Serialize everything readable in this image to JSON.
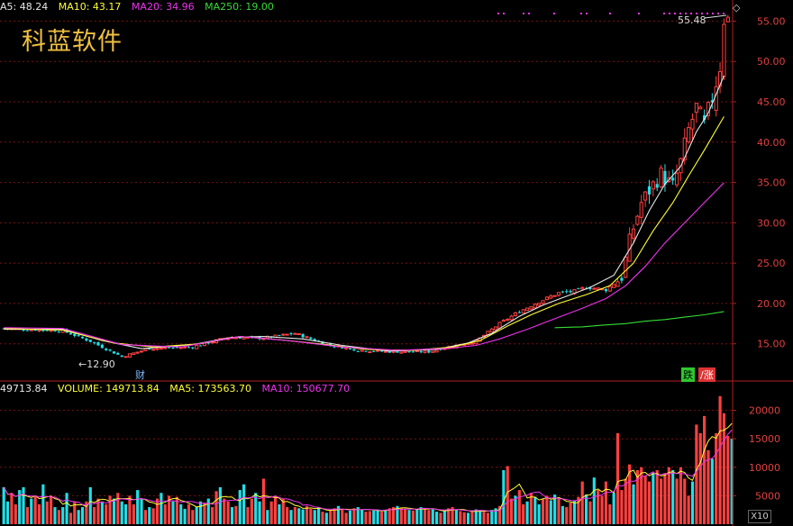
{
  "stock_name": "科蓝软件",
  "price_legend": {
    "ma5": "A5: 48.24",
    "ma10": "MA10: 43.17",
    "ma20": "MA20: 34.96",
    "ma250": "MA250: 19.00"
  },
  "volume_legend": {
    "current": "49713.84",
    "volume": "VOLUME: 149713.84",
    "ma5": "MA5: 173563.70",
    "ma10": "MA10: 150677.70"
  },
  "annotations": {
    "high": "55.48",
    "low": "12.90",
    "cai": "财",
    "die": "跌",
    "zhang": "涨"
  },
  "zoom_button": "X10",
  "colors": {
    "up": "#ff4040",
    "down": "#1fe0e8",
    "ma5": "#e8e8e8",
    "ma10": "#ffff33",
    "ma20": "#ee33ee",
    "ma250": "#33dd33",
    "grid": "#7a1010",
    "name": "#f0c040"
  },
  "chart_data": [
    {
      "type": "candlestick",
      "title": "科蓝软件",
      "ylim": [
        10.5,
        56.5
      ],
      "yticks": [
        "15.00",
        "20.00",
        "25.00",
        "30.00",
        "35.00",
        "40.00",
        "45.00",
        "50.00",
        "55.00"
      ],
      "grid": true,
      "close_path": [
        [
          0,
          16.9
        ],
        [
          15,
          16.6
        ],
        [
          22,
          15.3
        ],
        [
          30,
          13.4
        ],
        [
          37,
          14.4
        ],
        [
          48,
          14.6
        ],
        [
          57,
          15.8
        ],
        [
          66,
          15.7
        ],
        [
          74,
          16.3
        ],
        [
          82,
          14.9
        ],
        [
          90,
          14.2
        ],
        [
          98,
          14.0
        ],
        [
          108,
          14.0
        ],
        [
          113,
          14.6
        ],
        [
          120,
          15.3
        ],
        [
          126,
          17.5
        ],
        [
          131,
          19.0
        ],
        [
          136,
          20.2
        ],
        [
          141,
          21.3
        ],
        [
          145,
          21.5
        ],
        [
          148,
          22.0
        ],
        [
          153,
          21.7
        ],
        [
          157,
          23.2
        ],
        [
          159,
          27.8
        ],
        [
          162,
          32.5
        ],
        [
          165,
          34.7
        ],
        [
          167,
          36.0
        ],
        [
          170,
          34.5
        ],
        [
          172,
          37.5
        ],
        [
          174,
          41.5
        ],
        [
          176,
          44.2
        ],
        [
          178,
          42.0
        ],
        [
          180,
          45.5
        ],
        [
          182,
          49.5
        ],
        [
          183,
          55.48
        ]
      ],
      "series": [
        {
          "name": "MA5",
          "points": [
            [
              0,
              16.8
            ],
            [
              15,
              16.8
            ],
            [
              25,
              15.4
            ],
            [
              35,
              14.4
            ],
            [
              48,
              14.9
            ],
            [
              58,
              15.8
            ],
            [
              66,
              15.9
            ],
            [
              76,
              15.6
            ],
            [
              86,
              14.8
            ],
            [
              98,
              14.1
            ],
            [
              110,
              14.3
            ],
            [
              118,
              15.1
            ],
            [
              124,
              16.3
            ],
            [
              131,
              18.4
            ],
            [
              137,
              19.8
            ],
            [
              143,
              20.9
            ],
            [
              149,
              22.0
            ],
            [
              155,
              23.5
            ],
            [
              160,
              27.5
            ],
            [
              164,
              31.5
            ],
            [
              168,
              34.8
            ],
            [
              172,
              37.0
            ],
            [
              176,
              41.3
            ],
            [
              179,
              43.6
            ],
            [
              183,
              48.24
            ]
          ]
        },
        {
          "name": "MA10",
          "points": [
            [
              0,
              16.9
            ],
            [
              15,
              16.7
            ],
            [
              28,
              15.1
            ],
            [
              38,
              14.6
            ],
            [
              50,
              15.0
            ],
            [
              60,
              15.9
            ],
            [
              70,
              15.5
            ],
            [
              80,
              15.0
            ],
            [
              92,
              14.3
            ],
            [
              104,
              14.2
            ],
            [
              114,
              14.6
            ],
            [
              121,
              15.4
            ],
            [
              128,
              17.2
            ],
            [
              134,
              18.6
            ],
            [
              141,
              20.0
            ],
            [
              148,
              21.1
            ],
            [
              154,
              22.2
            ],
            [
              160,
              25.0
            ],
            [
              165,
              29.0
            ],
            [
              170,
              32.5
            ],
            [
              174,
              35.8
            ],
            [
              178,
              39.0
            ],
            [
              183,
              43.17
            ]
          ]
        },
        {
          "name": "MA20",
          "points": [
            [
              0,
              17.0
            ],
            [
              15,
              16.9
            ],
            [
              30,
              14.9
            ],
            [
              45,
              14.6
            ],
            [
              60,
              15.9
            ],
            [
              72,
              15.4
            ],
            [
              86,
              14.6
            ],
            [
              100,
              14.2
            ],
            [
              112,
              14.4
            ],
            [
              120,
              14.8
            ],
            [
              126,
              15.6
            ],
            [
              133,
              16.8
            ],
            [
              140,
              18.1
            ],
            [
              147,
              19.4
            ],
            [
              153,
              20.6
            ],
            [
              158,
              22.2
            ],
            [
              163,
              24.6
            ],
            [
              168,
              27.5
            ],
            [
              173,
              30.0
            ],
            [
              178,
              32.5
            ],
            [
              183,
              34.96
            ]
          ]
        },
        {
          "name": "MA250",
          "points": [
            [
              140,
              17.0
            ],
            [
              147,
              17.1
            ],
            [
              152,
              17.3
            ],
            [
              158,
              17.5
            ],
            [
              163,
              17.8
            ],
            [
              168,
              18.0
            ],
            [
              173,
              18.3
            ],
            [
              178,
              18.6
            ],
            [
              183,
              19.0
            ]
          ]
        }
      ]
    },
    {
      "type": "bar",
      "title": "VOLUME",
      "ylim": [
        0,
        25000
      ],
      "yticks": [
        "5000",
        "10000",
        "15000",
        "20000"
      ],
      "grid": true,
      "values": [
        6500,
        4000,
        5500,
        3500,
        6000,
        6500,
        3000,
        4500,
        5000,
        3500,
        7000,
        4000,
        5000,
        3000,
        2500,
        3000,
        5500,
        2000,
        4000,
        2500,
        3000,
        4000,
        6500,
        3000,
        4500,
        4000,
        3500,
        5000,
        4500,
        5500,
        4000,
        3500,
        5000,
        3500,
        6000,
        4500,
        2500,
        3000,
        2800,
        4500,
        5500,
        3500,
        5000,
        4000,
        4800,
        3500,
        2700,
        3500,
        2500,
        3000,
        4000,
        3800,
        4500,
        3000,
        5800,
        6500,
        4500,
        4000,
        3000,
        3200,
        6000,
        7000,
        3000,
        4500,
        5500,
        4000,
        8000,
        2500,
        4000,
        5000,
        3500,
        4500,
        3000,
        2500,
        3000,
        2800,
        2600,
        3200,
        2700,
        2500,
        3000,
        2200,
        2000,
        2500,
        2800,
        3200,
        2600,
        2000,
        2400,
        2800,
        3000,
        2500,
        2200,
        2300,
        2400,
        2600,
        2200,
        2500,
        2800,
        3000,
        3200,
        2800,
        2600,
        2500,
        2400,
        2700,
        3000,
        2800,
        2500,
        2600,
        2200,
        2000,
        2400,
        2800,
        3000,
        2500,
        2300,
        2100,
        2000,
        2300,
        2600,
        2400,
        2200,
        2000,
        2500,
        2800,
        3200,
        9500,
        10200,
        4500,
        5000,
        6000,
        3500,
        4000,
        5500,
        4800,
        3500,
        4500,
        5000,
        4200,
        5200,
        4500,
        3200,
        3000,
        3800,
        4200,
        4800,
        7500,
        5200,
        4000,
        8200,
        6000,
        5000,
        7500,
        3500,
        5500,
        16000,
        6000,
        8000,
        10500,
        7000,
        9500,
        10000,
        8500,
        7500,
        9000,
        9500,
        8000,
        9000,
        10000,
        9500,
        8000,
        10000,
        8000,
        5000,
        7500,
        17500,
        16000,
        19000,
        13000,
        11500,
        16000,
        22500,
        19500,
        15500,
        15000
      ]
    }
  ]
}
